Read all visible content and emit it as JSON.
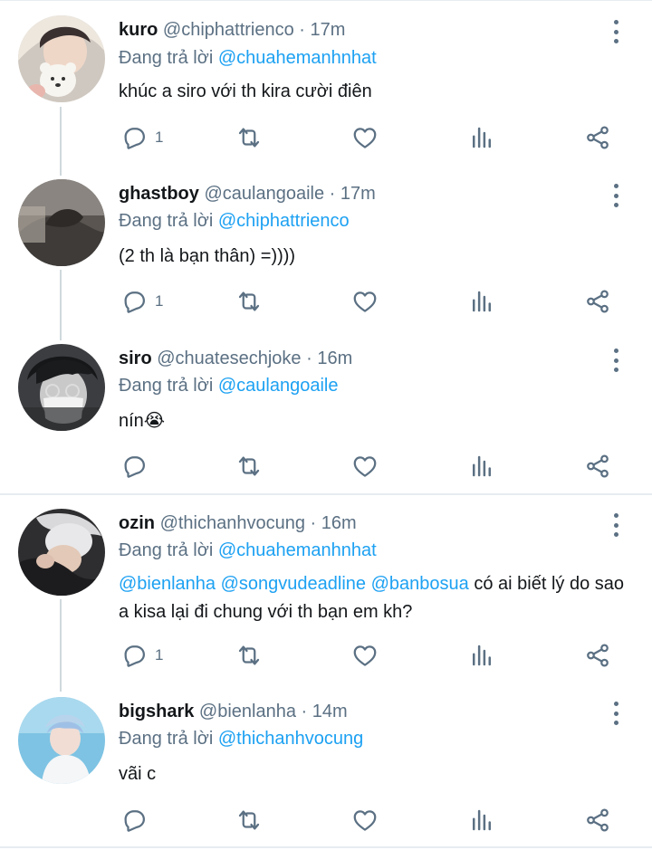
{
  "replying_prefix": "Đang trả lời",
  "colors": {
    "accent": "#1da1f2",
    "secondary": "#5b7083",
    "text": "#14171a",
    "divider": "#e6ecf0"
  },
  "tweets": [
    {
      "name": "kuro",
      "handle": "@chiphattrienco",
      "dot": "·",
      "time": "17m",
      "reply_to": "@chuahemanhnhat",
      "text": "khúc a siro với th kira cười điên",
      "reply_count": "1",
      "avatar_icon": "avatar-plush-bear"
    },
    {
      "name": "ghastboy",
      "handle": "@caulangoaile",
      "dot": "·",
      "time": "17m",
      "reply_to": "@chiphattrienco",
      "text": "(2 th là bạn thân) =))))",
      "reply_count": "1",
      "avatar_icon": "avatar-gray-hoodie"
    },
    {
      "name": "siro",
      "handle": "@chuatesechjoke",
      "dot": "·",
      "time": "16m",
      "reply_to": "@caulangoaile",
      "text": "nín😭",
      "reply_count": "",
      "avatar_icon": "avatar-mask-glasses"
    },
    {
      "name": "ozin",
      "handle": "@thichanhvocung",
      "dot": "·",
      "time": "16m",
      "reply_to": "@chuahemanhnhat",
      "mentions": [
        "@bienlanha",
        "@songvudeadline",
        "@banbosua"
      ],
      "text": "có ai biết lý do sao a kisa lại đi chung với th bạn em kh?",
      "reply_count": "1",
      "avatar_icon": "avatar-silver-hair"
    },
    {
      "name": "bigshark",
      "handle": "@bienlanha",
      "dot": "·",
      "time": "14m",
      "reply_to": "@thichanhvocung",
      "text": "vãi c",
      "reply_count": "",
      "avatar_icon": "avatar-blue-sea"
    }
  ]
}
